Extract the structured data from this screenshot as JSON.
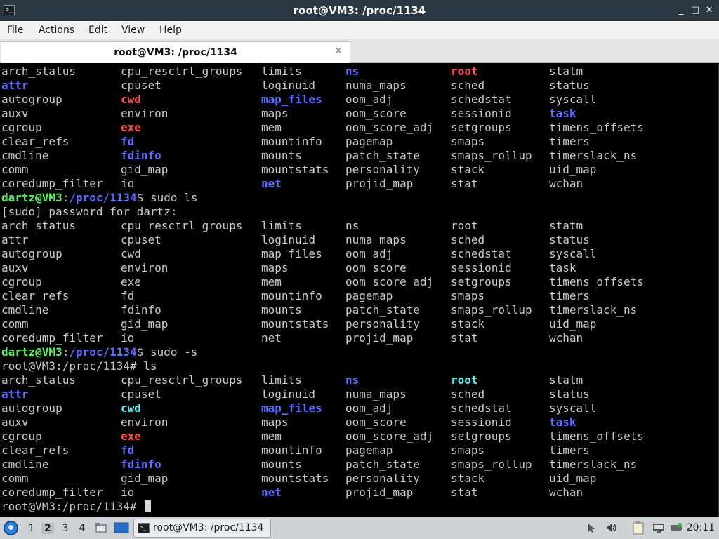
{
  "window": {
    "title": "root@VM3: /proc/1134",
    "icon": "terminal-icon",
    "controls": {
      "minimize": "_",
      "maximize": "□",
      "close": "✕"
    }
  },
  "menu": [
    "File",
    "Actions",
    "Edit",
    "View",
    "Help"
  ],
  "tab": {
    "label": "root@VM3: /proc/1134",
    "close": "×"
  },
  "terminal": {
    "colors": {
      "background": "#000000",
      "text": "#c8c8c8",
      "dir": "#5c6cff",
      "link": "#5cf4f4",
      "red": "#ff5050",
      "prompt_user": "#5df05d"
    },
    "lines": [
      {
        "cells": [
          {
            "t": "arch_status"
          },
          {
            "t": "cpu_resctrl_groups"
          },
          {
            "t": "limits"
          },
          {
            "t": "ns",
            "s": "dir"
          },
          {
            "t": "root",
            "s": "red"
          },
          {
            "t": "statm"
          }
        ]
      },
      {
        "cells": [
          {
            "t": "attr",
            "s": "dir"
          },
          {
            "t": "cpuset"
          },
          {
            "t": "loginuid"
          },
          {
            "t": "numa_maps"
          },
          {
            "t": "sched"
          },
          {
            "t": "status"
          }
        ]
      },
      {
        "cells": [
          {
            "t": "autogroup"
          },
          {
            "t": "cwd",
            "s": "red"
          },
          {
            "t": "map_files",
            "s": "dir"
          },
          {
            "t": "oom_adj"
          },
          {
            "t": "schedstat"
          },
          {
            "t": "syscall"
          }
        ]
      },
      {
        "cells": [
          {
            "t": "auxv"
          },
          {
            "t": "environ"
          },
          {
            "t": "maps"
          },
          {
            "t": "oom_score"
          },
          {
            "t": "sessionid"
          },
          {
            "t": "task",
            "s": "dir"
          }
        ]
      },
      {
        "cells": [
          {
            "t": "cgroup"
          },
          {
            "t": "exe",
            "s": "red"
          },
          {
            "t": "mem"
          },
          {
            "t": "oom_score_adj"
          },
          {
            "t": "setgroups"
          },
          {
            "t": "timens_offsets"
          }
        ]
      },
      {
        "cells": [
          {
            "t": "clear_refs"
          },
          {
            "t": "fd",
            "s": "dir"
          },
          {
            "t": "mountinfo"
          },
          {
            "t": "pagemap"
          },
          {
            "t": "smaps"
          },
          {
            "t": "timers"
          }
        ]
      },
      {
        "cells": [
          {
            "t": "cmdline"
          },
          {
            "t": "fdinfo",
            "s": "dir"
          },
          {
            "t": "mounts"
          },
          {
            "t": "patch_state"
          },
          {
            "t": "smaps_rollup"
          },
          {
            "t": "timerslack_ns"
          }
        ]
      },
      {
        "cells": [
          {
            "t": "comm"
          },
          {
            "t": "gid_map"
          },
          {
            "t": "mountstats"
          },
          {
            "t": "personality"
          },
          {
            "t": "stack"
          },
          {
            "t": "uid_map"
          }
        ]
      },
      {
        "cells": [
          {
            "t": "coredump_filter"
          },
          {
            "t": "io"
          },
          {
            "t": "net",
            "s": "dir"
          },
          {
            "t": "projid_map"
          },
          {
            "t": "stat"
          },
          {
            "t": "wchan"
          }
        ]
      },
      {
        "prompt": [
          {
            "t": "dartz@VM3",
            "s": "pu"
          },
          {
            "t": ":"
          },
          {
            "t": "/proc/1134",
            "s": "pp"
          },
          {
            "t": "$ sudo ls"
          }
        ]
      },
      {
        "text": "[sudo] password for dartz:"
      },
      {
        "cells": [
          {
            "t": "arch_status"
          },
          {
            "t": "cpu_resctrl_groups"
          },
          {
            "t": "limits"
          },
          {
            "t": "ns"
          },
          {
            "t": "root"
          },
          {
            "t": "statm"
          }
        ]
      },
      {
        "cells": [
          {
            "t": "attr"
          },
          {
            "t": "cpuset"
          },
          {
            "t": "loginuid"
          },
          {
            "t": "numa_maps"
          },
          {
            "t": "sched"
          },
          {
            "t": "status"
          }
        ]
      },
      {
        "cells": [
          {
            "t": "autogroup"
          },
          {
            "t": "cwd"
          },
          {
            "t": "map_files"
          },
          {
            "t": "oom_adj"
          },
          {
            "t": "schedstat"
          },
          {
            "t": "syscall"
          }
        ]
      },
      {
        "cells": [
          {
            "t": "auxv"
          },
          {
            "t": "environ"
          },
          {
            "t": "maps"
          },
          {
            "t": "oom_score"
          },
          {
            "t": "sessionid"
          },
          {
            "t": "task"
          }
        ]
      },
      {
        "cells": [
          {
            "t": "cgroup"
          },
          {
            "t": "exe"
          },
          {
            "t": "mem"
          },
          {
            "t": "oom_score_adj"
          },
          {
            "t": "setgroups"
          },
          {
            "t": "timens_offsets"
          }
        ]
      },
      {
        "cells": [
          {
            "t": "clear_refs"
          },
          {
            "t": "fd"
          },
          {
            "t": "mountinfo"
          },
          {
            "t": "pagemap"
          },
          {
            "t": "smaps"
          },
          {
            "t": "timers"
          }
        ]
      },
      {
        "cells": [
          {
            "t": "cmdline"
          },
          {
            "t": "fdinfo"
          },
          {
            "t": "mounts"
          },
          {
            "t": "patch_state"
          },
          {
            "t": "smaps_rollup"
          },
          {
            "t": "timerslack_ns"
          }
        ]
      },
      {
        "cells": [
          {
            "t": "comm"
          },
          {
            "t": "gid_map"
          },
          {
            "t": "mountstats"
          },
          {
            "t": "personality"
          },
          {
            "t": "stack"
          },
          {
            "t": "uid_map"
          }
        ]
      },
      {
        "cells": [
          {
            "t": "coredump_filter"
          },
          {
            "t": "io"
          },
          {
            "t": "net"
          },
          {
            "t": "projid_map"
          },
          {
            "t": "stat"
          },
          {
            "t": "wchan"
          }
        ]
      },
      {
        "prompt": [
          {
            "t": "dartz@VM3",
            "s": "pu"
          },
          {
            "t": ":"
          },
          {
            "t": "/proc/1134",
            "s": "pp"
          },
          {
            "t": "$ sudo -s"
          }
        ]
      },
      {
        "text": "root@VM3:/proc/1134# ls"
      },
      {
        "cells": [
          {
            "t": "arch_status"
          },
          {
            "t": "cpu_resctrl_groups"
          },
          {
            "t": "limits"
          },
          {
            "t": "ns",
            "s": "dir"
          },
          {
            "t": "root",
            "s": "link"
          },
          {
            "t": "statm"
          }
        ]
      },
      {
        "cells": [
          {
            "t": "attr",
            "s": "dir"
          },
          {
            "t": "cpuset"
          },
          {
            "t": "loginuid"
          },
          {
            "t": "numa_maps"
          },
          {
            "t": "sched"
          },
          {
            "t": "status"
          }
        ]
      },
      {
        "cells": [
          {
            "t": "autogroup"
          },
          {
            "t": "cwd",
            "s": "link"
          },
          {
            "t": "map_files",
            "s": "dir"
          },
          {
            "t": "oom_adj"
          },
          {
            "t": "schedstat"
          },
          {
            "t": "syscall"
          }
        ]
      },
      {
        "cells": [
          {
            "t": "auxv"
          },
          {
            "t": "environ"
          },
          {
            "t": "maps"
          },
          {
            "t": "oom_score"
          },
          {
            "t": "sessionid"
          },
          {
            "t": "task",
            "s": "dir"
          }
        ]
      },
      {
        "cells": [
          {
            "t": "cgroup"
          },
          {
            "t": "exe",
            "s": "red"
          },
          {
            "t": "mem"
          },
          {
            "t": "oom_score_adj"
          },
          {
            "t": "setgroups"
          },
          {
            "t": "timens_offsets"
          }
        ]
      },
      {
        "cells": [
          {
            "t": "clear_refs"
          },
          {
            "t": "fd",
            "s": "dir"
          },
          {
            "t": "mountinfo"
          },
          {
            "t": "pagemap"
          },
          {
            "t": "smaps"
          },
          {
            "t": "timers"
          }
        ]
      },
      {
        "cells": [
          {
            "t": "cmdline"
          },
          {
            "t": "fdinfo",
            "s": "dir"
          },
          {
            "t": "mounts"
          },
          {
            "t": "patch_state"
          },
          {
            "t": "smaps_rollup"
          },
          {
            "t": "timerslack_ns"
          }
        ]
      },
      {
        "cells": [
          {
            "t": "comm"
          },
          {
            "t": "gid_map"
          },
          {
            "t": "mountstats"
          },
          {
            "t": "personality"
          },
          {
            "t": "stack"
          },
          {
            "t": "uid_map"
          }
        ]
      },
      {
        "cells": [
          {
            "t": "coredump_filter"
          },
          {
            "t": "io"
          },
          {
            "t": "net",
            "s": "dir"
          },
          {
            "t": "projid_map"
          },
          {
            "t": "stat"
          },
          {
            "t": "wchan"
          }
        ]
      },
      {
        "text": "root@VM3:/proc/1134# ",
        "cursor": true
      }
    ]
  },
  "taskbar": {
    "start_icon": "app-menu-icon",
    "workspaces": [
      "1",
      "2",
      "3",
      "4"
    ],
    "active_workspace": "2",
    "launchers": [
      "file-manager-icon",
      "show-desktop-icon"
    ],
    "task": {
      "label": "root@VM3: /proc/1134",
      "icon": "terminal-icon"
    },
    "tray": [
      "input-icon",
      "volume-icon",
      "clipboard-icon",
      "network-icon",
      "power-icon"
    ],
    "clock": "20:11"
  }
}
